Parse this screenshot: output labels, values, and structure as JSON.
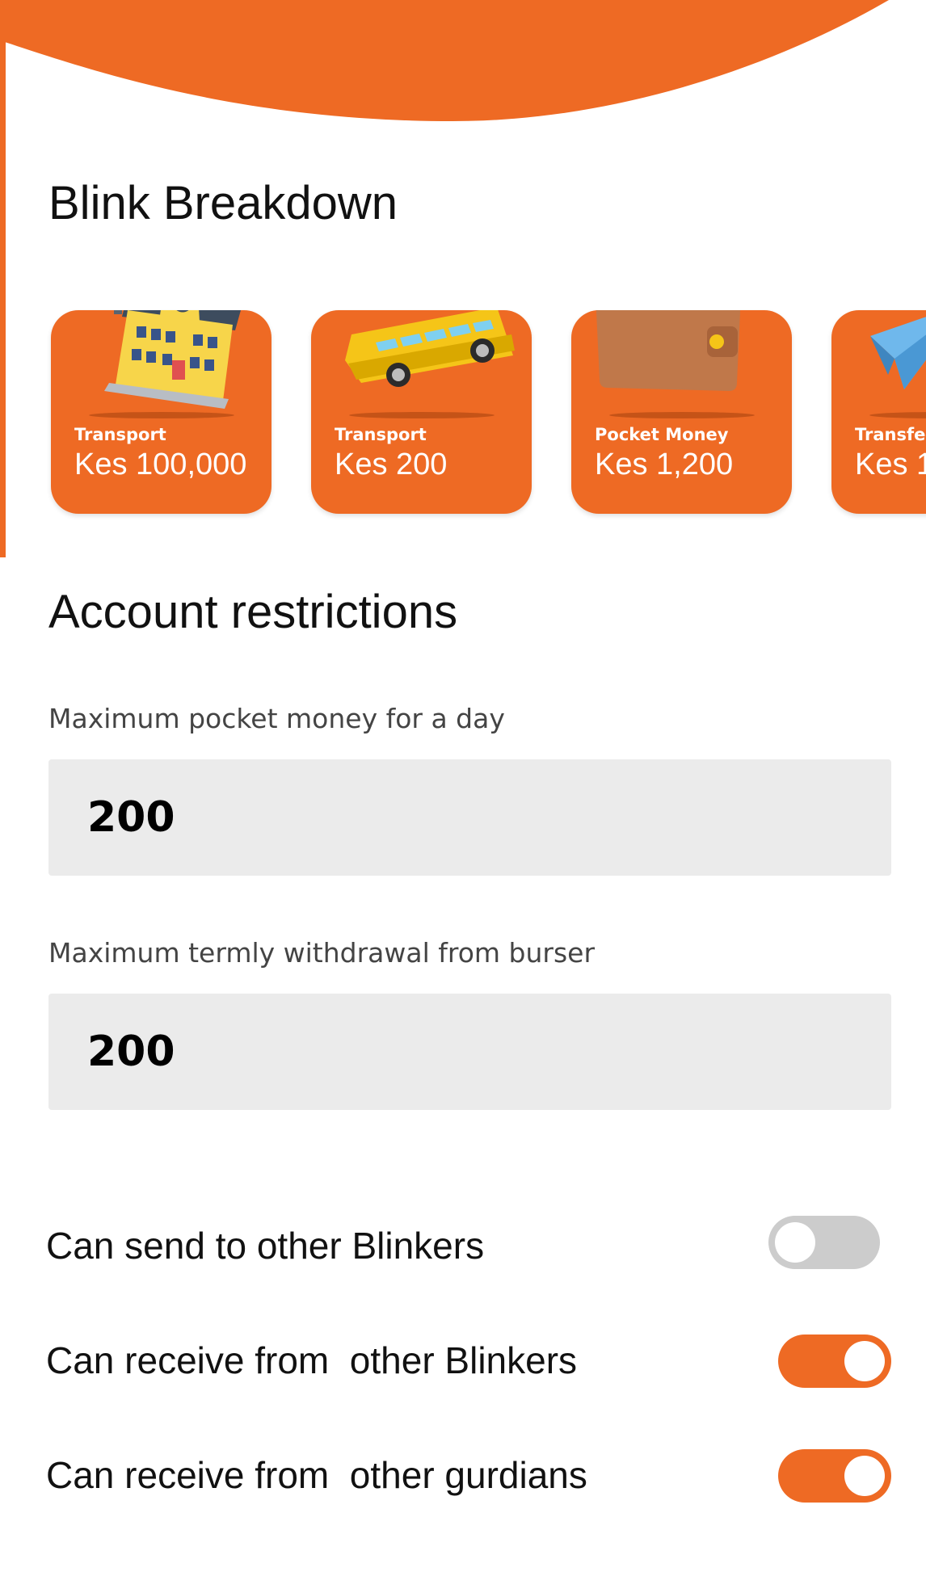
{
  "colors": {
    "accent": "#ee6a24",
    "field_background": "#ebebeb",
    "toggle_off": "#cccccc"
  },
  "breakdown": {
    "title": "Blink Breakdown",
    "cards": [
      {
        "icon": "school-building-icon",
        "label": "Transport",
        "amount": "Kes 100,000"
      },
      {
        "icon": "bus-icon",
        "label": "Transport",
        "amount": "Kes 200"
      },
      {
        "icon": "wallet-icon",
        "label": "Pocket Money",
        "amount": "Kes 1,200"
      },
      {
        "icon": "paper-plane-icon",
        "label": "Transfer",
        "amount": "Kes 1"
      }
    ]
  },
  "restrictions": {
    "title": "Account restrictions",
    "fields": [
      {
        "label": "Maximum pocket money for a day",
        "value": "200"
      },
      {
        "label": "Maximum termly withdrawal from burser",
        "value": "200"
      }
    ],
    "toggles": [
      {
        "label": "Can send to other Blinkers",
        "enabled": false
      },
      {
        "label": "Can receive from  other Blinkers",
        "enabled": true
      },
      {
        "label": "Can receive from  other gurdians",
        "enabled": true
      }
    ]
  }
}
